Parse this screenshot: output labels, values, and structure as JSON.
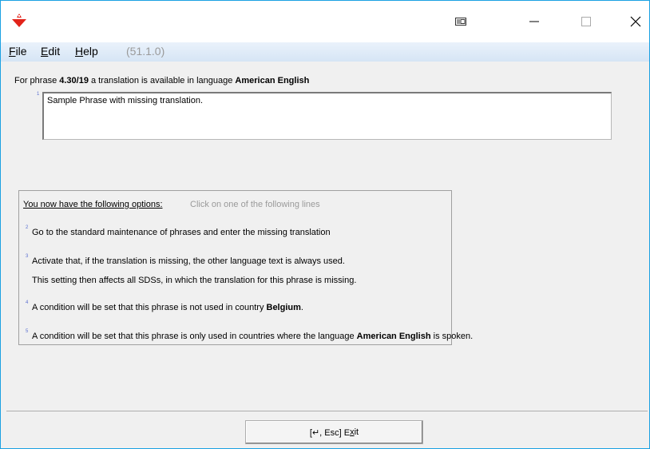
{
  "menu": {
    "file": {
      "pre": "",
      "u": "F",
      "post": "ile"
    },
    "edit": {
      "pre": "",
      "u": "E",
      "post": "dit"
    },
    "help": {
      "pre": "",
      "u": "H",
      "post": "elp"
    },
    "version": "(51.1.0)"
  },
  "phrase": {
    "prefix": "For phrase ",
    "id": "4.30/19",
    "middle": " a translation is available in language ",
    "language": "American English",
    "num": "1",
    "text": "Sample Phrase with missing translation."
  },
  "options": {
    "header": "You now have the following options:",
    "hint": "Click on one of the following lines",
    "opt2": {
      "num": "2",
      "text": "Go to the standard maintenance of phrases and enter the missing translation"
    },
    "opt3": {
      "num": "3",
      "line1": "Activate that, if the translation is missing, the other language text is always used.",
      "line2": "This setting then affects all SDSs, in which the translation for this phrase is missing."
    },
    "opt4": {
      "num": "4",
      "prefix": "A condition will be set that this phrase is not used in country ",
      "country": "Belgium",
      "suffix": "."
    },
    "opt5": {
      "num": "5",
      "prefix": "A condition will be set that this phrase is only used in countries where the language ",
      "language": "American English",
      "suffix": " is spoken."
    }
  },
  "exit_button": {
    "pre": "[↵, Esc] E",
    "u": "x",
    "post": "it"
  },
  "colors": {
    "accent": "#1ba1e2",
    "menu_bg": "#dce8f5",
    "app_icon_red": "#e2231a"
  }
}
